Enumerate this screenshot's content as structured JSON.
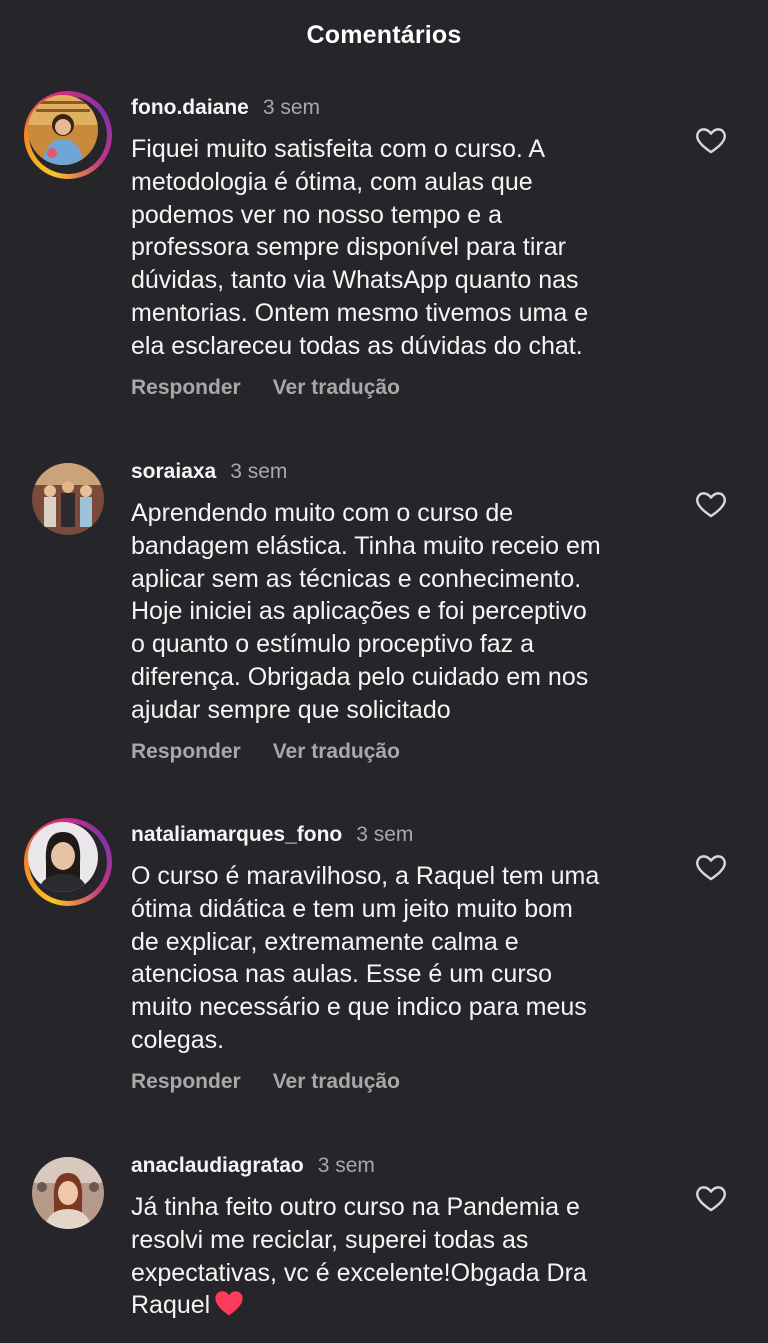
{
  "header": {
    "title": "Comentários"
  },
  "actions": {
    "reply_label": "Responder",
    "translate_label": "Ver tradução"
  },
  "comments": [
    {
      "username": "fono.daiane",
      "time": "3 sem",
      "text": "Fiquei muito satisfeita com o curso. A\nmetodologia é ótima, com aulas que\npodemos ver no nosso tempo e a\nprofessora sempre disponível para tirar\ndúvidas, tanto via WhatsApp quanto nas\nmentorias. Ontem mesmo tivemos uma e\nela esclareceu todas as dúvidas do chat.",
      "has_story_ring": true
    },
    {
      "username": "soraiaxa",
      "time": "3 sem",
      "text": "Aprendendo muito com o curso  de\nbandagem elástica. Tinha muito receio em\naplicar sem as técnicas e conhecimento.\nHoje iniciei as aplicações e foi perceptivo\no quanto o estímulo proceptivo  faz a\ndiferença.  Obrigada pelo cuidado em nos\najudar sempre que solicitado",
      "has_story_ring": false
    },
    {
      "username": "nataliamarques_fono",
      "time": "3 sem",
      "text": "O curso é maravilhoso, a Raquel tem uma\nótima didática e tem um jeito muito bom\nde explicar, extremamente calma e\natenciosa nas aulas. Esse é um curso\nmuito necessário e que indico para meus\ncolegas.",
      "has_story_ring": true
    },
    {
      "username": "anaclaudiagratao",
      "time": "3 sem",
      "text": "Já tinha feito outro curso na Pandemia e\nresolvi me reciclar, superei todas as\nexpectativas, vc é excelente!Obgada Dra\nRaquel",
      "has_story_ring": false
    }
  ],
  "icons": {
    "like": "heart-outline-icon",
    "emoji": "red-heart-emoji"
  },
  "colors": {
    "background": "#26262a",
    "secondary_text": "#a8a8a8",
    "emoji_heart": "#ff3b5c"
  }
}
